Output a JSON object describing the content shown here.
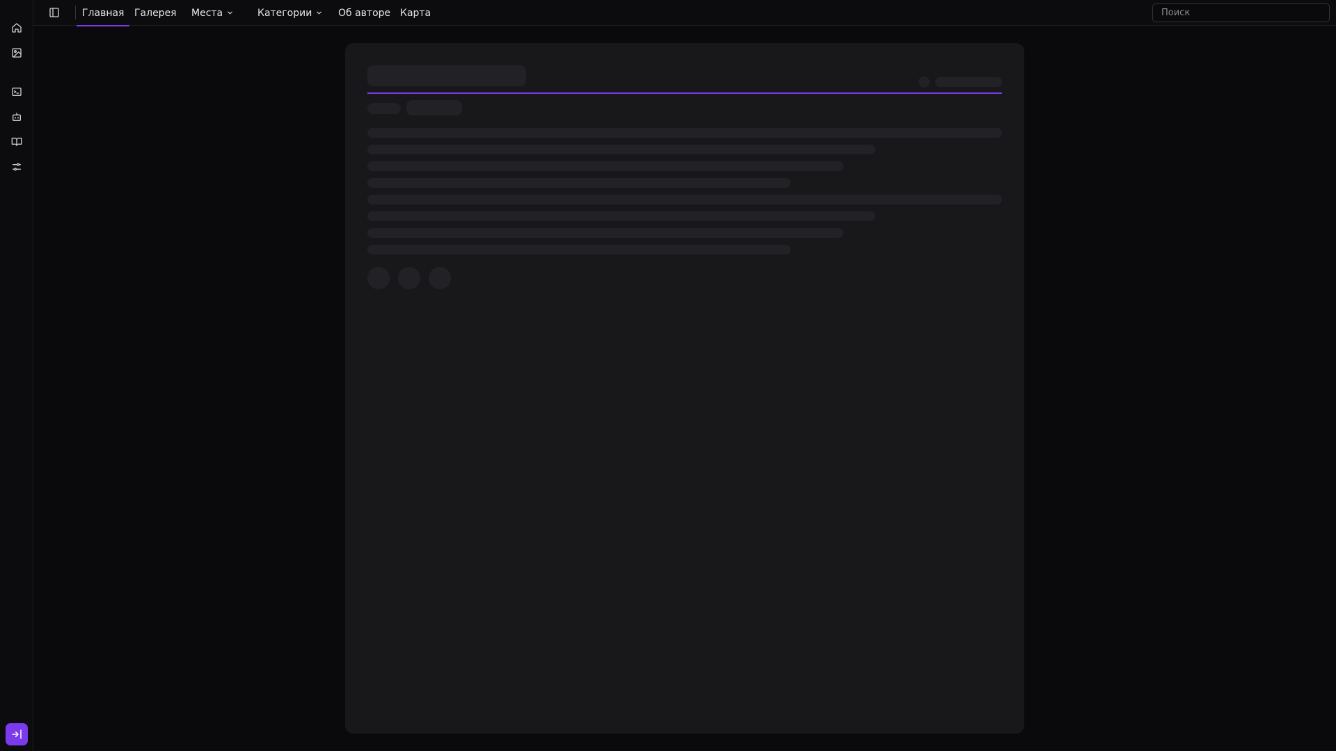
{
  "nav": {
    "items": [
      {
        "label": "Главная",
        "active": true,
        "dropdown": false
      },
      {
        "label": "Галерея",
        "active": false,
        "dropdown": false
      },
      {
        "label": "Места",
        "active": false,
        "dropdown": true
      },
      {
        "label": "Категории",
        "active": false,
        "dropdown": true
      },
      {
        "label": "Об авторе",
        "active": false,
        "dropdown": false
      },
      {
        "label": "Карта",
        "active": false,
        "dropdown": false
      }
    ]
  },
  "search": {
    "placeholder": "Поиск",
    "value": ""
  },
  "rail": {
    "icons": [
      "home-icon",
      "image-icon",
      "terminal-icon",
      "robot-icon",
      "book-icon",
      "sliders-icon"
    ],
    "bottom_icon": "login-icon"
  },
  "colors": {
    "accent": "#7c3aed",
    "background": "#0a0a0c",
    "card": "#18181b",
    "skeleton": "#222226"
  },
  "card": {
    "state": "loading"
  }
}
